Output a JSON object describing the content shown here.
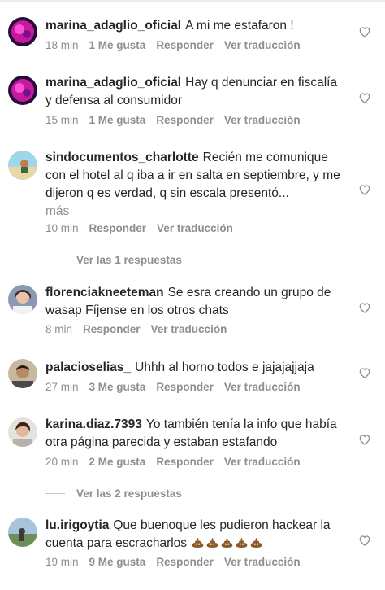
{
  "comments": [
    {
      "username": "marina_adaglio_oficial",
      "text": "A mi me estafaron !",
      "time": "18 min",
      "likes": "1 Me gusta",
      "reply": "Responder",
      "translate": "Ver traducción",
      "avatar": "avatar-pink-neon"
    },
    {
      "username": "marina_adaglio_oficial",
      "text": "Hay q denunciar en fiscalía y defensa al consumidor",
      "time": "15 min",
      "likes": "1 Me gusta",
      "reply": "Responder",
      "translate": "Ver traducción",
      "avatar": "avatar-pink-neon"
    },
    {
      "username": "sindocumentos_charlotte",
      "text": "Recién me comunique con el hotel al q iba a ir en salta en septiembre, y me dijeron q es verdad, q sin escala presentó...",
      "more": "más",
      "time": "10 min",
      "reply": "Responder",
      "translate": "Ver traducción",
      "avatar": "avatar-beach",
      "replies_label": "Ver las 1 respuestas"
    },
    {
      "username": "florenciakneeteman",
      "text": "Se esra creando un grupo de wasap Fíjense en los otros chats",
      "time": "8 min",
      "reply": "Responder",
      "translate": "Ver traducción",
      "avatar": "avatar-selfie"
    },
    {
      "username": "palacioselias_",
      "text": "Uhhh al horno todos e jajajajjaja",
      "time": "27 min",
      "likes": "3 Me gusta",
      "reply": "Responder",
      "translate": "Ver traducción",
      "avatar": "avatar-man"
    },
    {
      "username": "karina.diaz.7393",
      "text": "Yo también tenía la info que había otra página parecida y estaban estafando",
      "time": "20 min",
      "likes": "2 Me gusta",
      "reply": "Responder",
      "translate": "Ver traducción",
      "avatar": "avatar-woman",
      "replies_label": "Ver las 2 respuestas"
    },
    {
      "username": "lu.irigoytia",
      "text": "Que buenoque les pudieron hackear la cuenta para escracharlos",
      "emoji_count": 5,
      "time": "19 min",
      "likes": "9 Me gusta",
      "reply": "Responder",
      "translate": "Ver traducción",
      "avatar": "avatar-landscape"
    }
  ],
  "icons": {
    "like": "heart-outline-icon",
    "emoji": "pile-of-poo-emoji"
  },
  "colors": {
    "text": "#262626",
    "secondary": "#8e8e8e",
    "background": "#ffffff"
  }
}
